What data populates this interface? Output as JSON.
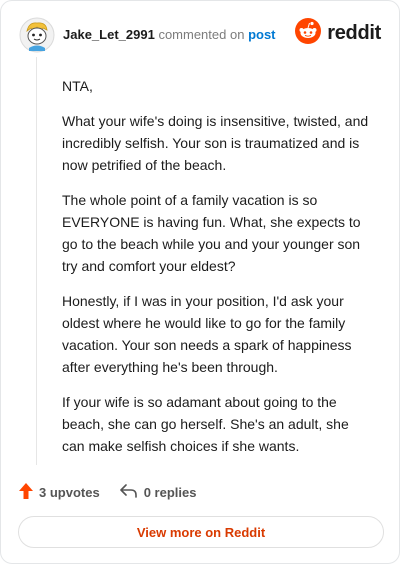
{
  "comment": {
    "username": "Jake_Let_2991",
    "commented_on_text": "commented on",
    "post_link": "post",
    "paragraphs": [
      "NTA,",
      "What your wife's doing is insensitive, twisted, and incredibly selfish. Your son is traumatized and is now petrified of the beach.",
      "The whole point of a family vacation is so EVERYONE is having fun. What, she expects to go to the beach while you and your younger son try and comfort your eldest?",
      "Honestly, if I was in your position, I'd ask your oldest where he would like to go for the family vacation. Your son needs a spark of happiness after everything he's been through.",
      "If your wife is so adamant about going to the beach, she can go herself. She's an adult, she can make selfish choices if she wants."
    ]
  },
  "brand": {
    "name": "reddit",
    "color": "#ff4500"
  },
  "actions": {
    "upvotes": "3 upvotes",
    "replies": "0 replies",
    "upvote_color": "#ff4500"
  },
  "view_more": "View more on Reddit",
  "icons": [
    "avatar",
    "reddit-logo-icon",
    "upvote-arrow-icon",
    "reply-icon"
  ]
}
